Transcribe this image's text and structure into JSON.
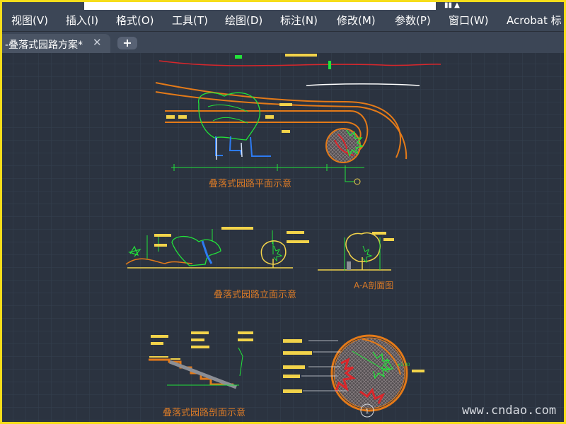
{
  "menu": {
    "items": [
      {
        "label": "视图(V)"
      },
      {
        "label": "插入(I)"
      },
      {
        "label": "格式(O)"
      },
      {
        "label": "工具(T)"
      },
      {
        "label": "绘图(D)"
      },
      {
        "label": "标注(N)"
      },
      {
        "label": "修改(M)"
      },
      {
        "label": "参数(P)"
      },
      {
        "label": "窗口(W)"
      },
      {
        "label": "Acrobat 标"
      }
    ]
  },
  "document_tab": {
    "label": "-叠落式园路方案*",
    "close_symbol": "✕"
  },
  "new_tab": {
    "symbol": "+"
  },
  "drawing": {
    "plan_title": "叠落式园路平面示意",
    "elevation_title": "叠落式园路立面示意",
    "section_title": "A-A剖面图",
    "stair_title_partial": "叠落式园路剖面示意",
    "detail_dim": "±1.00",
    "marker_number": "1"
  },
  "watermark": "www.cndao.com",
  "colors": {
    "background": "#2b3340",
    "frame": "#f6dd1a",
    "cad_green": "#22e23a",
    "cad_orange": "#e47a18",
    "cad_yellow": "#f2d34a",
    "cad_red": "#d9262b",
    "title_orange": "#d97a27"
  }
}
